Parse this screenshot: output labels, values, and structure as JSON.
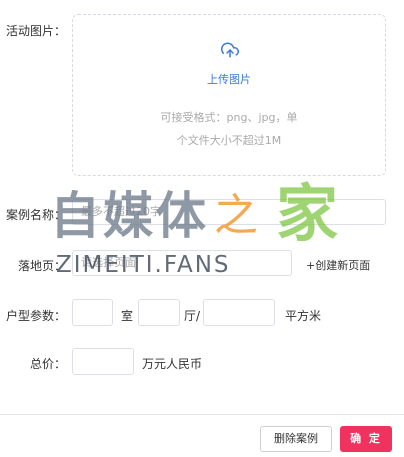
{
  "form": {
    "activity_image_label": "活动图片：",
    "upload": {
      "icon": "upload-cloud-icon",
      "text": "上传图片",
      "hint_line1": "可接受格式：png、jpg，单",
      "hint_line2": "个文件大小不超过1M"
    },
    "case_name": {
      "label": "案例名称：",
      "placeholder": "最多不超过20字"
    },
    "landing_page": {
      "label": "落地页：",
      "placeholder": "请选择页面",
      "create_link": "+创建新页面"
    },
    "floor_plan": {
      "label": "户型参数：",
      "room_unit": "室",
      "hall_unit": "厅/",
      "area_unit": "平方米"
    },
    "total_price": {
      "label": "总价：",
      "unit": "万元人民币"
    }
  },
  "footer": {
    "delete_label": "删除案例",
    "confirm_label": "确 定"
  },
  "watermark": {
    "cn_text": "自媒体",
    "zhi": "之",
    "jia": "家",
    "en_text": "ZIMEITI.FANS"
  },
  "colors": {
    "accent_blue": "#3a7bd5",
    "confirm_red": "#f0325f"
  }
}
